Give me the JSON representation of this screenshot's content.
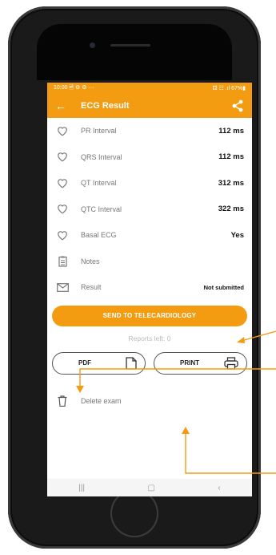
{
  "status_bar": {
    "time": "10:00",
    "left_extras": "🖻 ⚙ ⚙ ···",
    "right_extras": "⚃ ☷ .ıl 67%▮"
  },
  "app_bar": {
    "title": "ECG Result"
  },
  "rows": [
    {
      "label": "PR Interval",
      "value": "112 ms",
      "icon": "heart-icon"
    },
    {
      "label": "QRS Interval",
      "value": "112 ms",
      "icon": "heart-icon"
    },
    {
      "label": "QT Interval",
      "value": "312 ms",
      "icon": "heart-icon"
    },
    {
      "label": "QTC Interval",
      "value": "322 ms",
      "icon": "heart-icon"
    },
    {
      "label": "Basal ECG",
      "value": "Yes",
      "icon": "heart-icon"
    },
    {
      "label": "Notes",
      "value": "",
      "icon": "notes-icon"
    },
    {
      "label": "Result",
      "value": "Not submitted",
      "icon": "envelope-icon"
    }
  ],
  "actions": {
    "telecardiology_label": "SEND TO TELECARDIOLOGY",
    "reports_left": "Reports left: 0",
    "pdf_label": "PDF",
    "print_label": "PRINT",
    "delete_label": "Delete exam"
  },
  "colors": {
    "accent": "#f39c12"
  }
}
